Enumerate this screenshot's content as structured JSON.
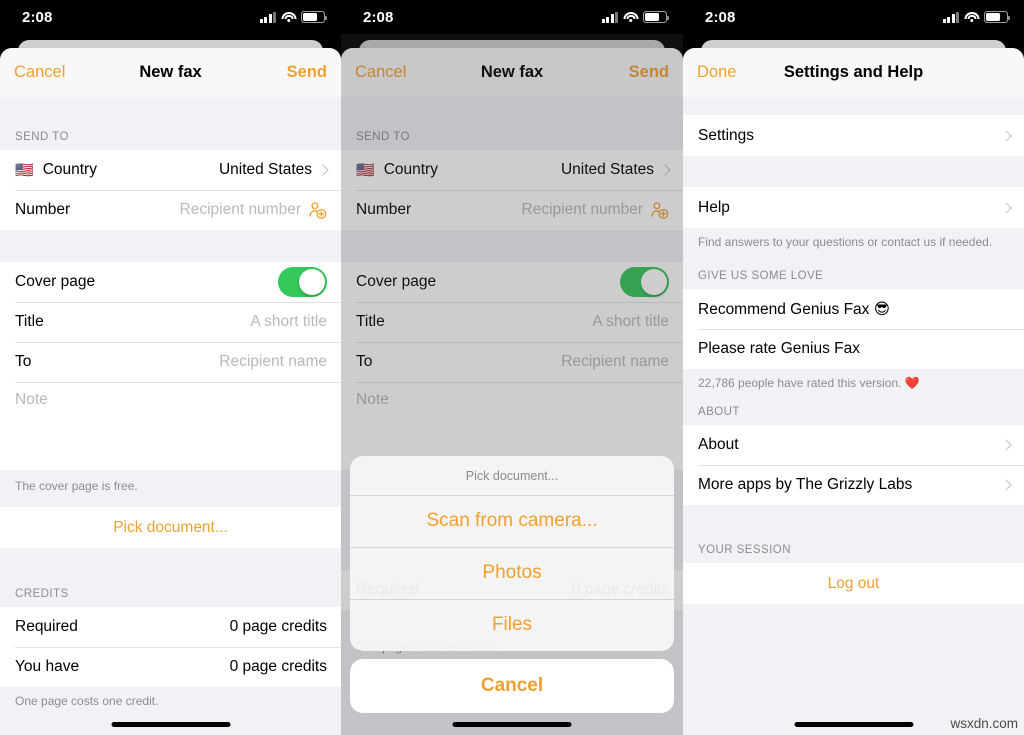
{
  "statusbar": {
    "time": "2:08",
    "signal_icon": "cellular-bars-icon",
    "wifi_icon": "wifi-icon",
    "battery_icon": "battery-icon"
  },
  "panel1": {
    "nav": {
      "left": "Cancel",
      "title": "New fax",
      "right": "Send"
    },
    "send_to": {
      "header": "SEND TO",
      "country": {
        "label": "Country",
        "value": "United States",
        "flag": "🇺🇸"
      },
      "number": {
        "label": "Number",
        "placeholder": "Recipient number"
      }
    },
    "cover": {
      "toggle_label": "Cover page",
      "toggle_on": true,
      "title": {
        "label": "Title",
        "placeholder": "A short title"
      },
      "to": {
        "label": "To",
        "placeholder": "Recipient name"
      },
      "note_placeholder": "Note",
      "footnote": "The cover page is free."
    },
    "pick_document": "Pick document...",
    "credits": {
      "header": "CREDITS",
      "rows": [
        {
          "label": "Required",
          "value": "0 page credits"
        },
        {
          "label": "You have",
          "value": "0 page credits"
        }
      ],
      "footnote": "One page costs one credit."
    }
  },
  "panel2": {
    "nav": {
      "left": "Cancel",
      "title": "New fax",
      "right": "Send"
    },
    "send_to": {
      "header": "SEND TO",
      "country": {
        "label": "Country",
        "value": "United States",
        "flag": "🇺🇸"
      },
      "number": {
        "label": "Number",
        "placeholder": "Recipient number"
      }
    },
    "cover": {
      "toggle_label": "Cover page",
      "toggle_on": true,
      "title": {
        "label": "Title",
        "placeholder": "A short title"
      },
      "to": {
        "label": "To",
        "placeholder": "Recipient name"
      },
      "note_placeholder": "Note"
    },
    "credits": {
      "row_label": "Required",
      "row_value": "0 page credits",
      "footnote": "One page costs one credit."
    },
    "actionsheet": {
      "title": "Pick document...",
      "items": [
        "Scan from camera...",
        "Photos",
        "Files"
      ],
      "cancel": "Cancel"
    }
  },
  "panel3": {
    "nav": {
      "left": "Done",
      "title": "Settings and Help"
    },
    "settings_row": "Settings",
    "help_row": "Help",
    "help_footnote": "Find answers to your questions or contact us if needed.",
    "love": {
      "header": "GIVE US SOME LOVE",
      "recommend": "Recommend Genius Fax 😎",
      "rate": "Please rate Genius Fax",
      "footnote": "22,786 people have rated this version. ❤️"
    },
    "about": {
      "header": "ABOUT",
      "rows": [
        "About",
        "More apps by The Grizzly Labs"
      ]
    },
    "session": {
      "header": "YOUR SESSION",
      "logout": "Log out"
    }
  },
  "watermark": "wsxdn.com",
  "colors": {
    "accent": "#f0a030",
    "toggle_on": "#34c759",
    "group_bg": "#f2f2f6",
    "cell_bg": "#ffffff"
  }
}
